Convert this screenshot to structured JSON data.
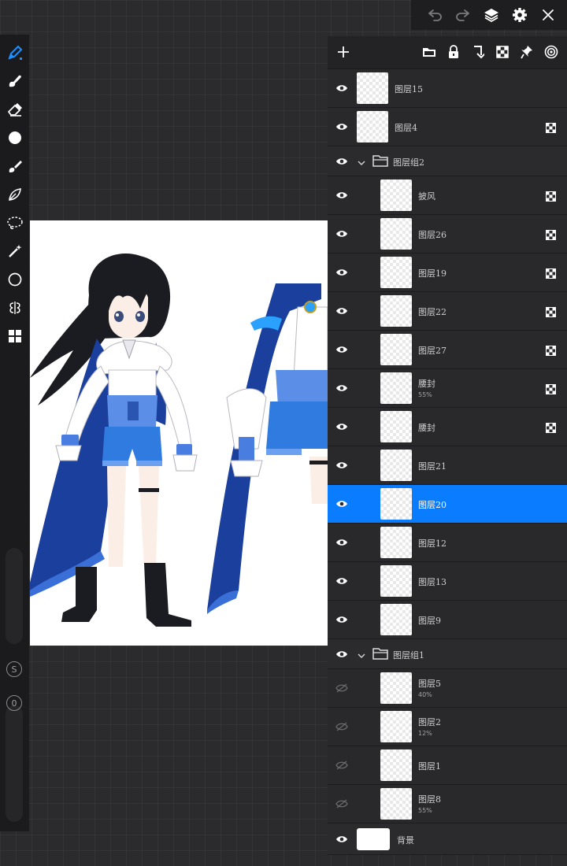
{
  "toolbar_top": {
    "icons": [
      "undo-icon",
      "redo-icon",
      "layers-icon",
      "settings-icon",
      "close-icon"
    ]
  },
  "left_tools": {
    "icons": [
      "brush-icon",
      "smudge-icon",
      "eraser-icon",
      "color-circle-icon",
      "fill-brush-icon",
      "vector-icon",
      "lasso-icon",
      "magic-wand-icon",
      "shape-circle-icon",
      "symmetry-icon",
      "grid-icon"
    ],
    "size_label": "S",
    "opacity_label": "0"
  },
  "layers_panel": {
    "add_icon": "plus-icon",
    "toolbar_icons": [
      "folder-icon",
      "lock-icon",
      "merge-down-icon",
      "checker-icon",
      "pin-icon",
      "target-icon"
    ],
    "layers": [
      {
        "kind": "layer",
        "name": "图层15",
        "opacity": "",
        "visible": true,
        "mode_icon": false,
        "indent": 0,
        "selected": false
      },
      {
        "kind": "layer",
        "name": "图层4",
        "opacity": "",
        "visible": true,
        "mode_icon": true,
        "indent": 0,
        "selected": false
      },
      {
        "kind": "group",
        "name": "图层组2",
        "visible": true
      },
      {
        "kind": "layer",
        "name": "披风",
        "opacity": "",
        "visible": true,
        "mode_icon": true,
        "indent": 1,
        "selected": false
      },
      {
        "kind": "layer",
        "name": "图层26",
        "opacity": "",
        "visible": true,
        "mode_icon": true,
        "indent": 1,
        "selected": false
      },
      {
        "kind": "layer",
        "name": "图层19",
        "opacity": "",
        "visible": true,
        "mode_icon": true,
        "indent": 1,
        "selected": false
      },
      {
        "kind": "layer",
        "name": "图层22",
        "opacity": "",
        "visible": true,
        "mode_icon": true,
        "indent": 1,
        "selected": false
      },
      {
        "kind": "layer",
        "name": "图层27",
        "opacity": "",
        "visible": true,
        "mode_icon": true,
        "indent": 1,
        "selected": false
      },
      {
        "kind": "layer",
        "name": "腰封",
        "opacity": "55%",
        "visible": true,
        "mode_icon": true,
        "indent": 1,
        "selected": false
      },
      {
        "kind": "layer",
        "name": "腰封",
        "opacity": "",
        "visible": true,
        "mode_icon": true,
        "indent": 1,
        "selected": false
      },
      {
        "kind": "layer",
        "name": "图层21",
        "opacity": "",
        "visible": true,
        "mode_icon": false,
        "indent": 1,
        "selected": false
      },
      {
        "kind": "layer",
        "name": "图层20",
        "opacity": "",
        "visible": true,
        "mode_icon": false,
        "indent": 1,
        "selected": true
      },
      {
        "kind": "layer",
        "name": "图层12",
        "opacity": "",
        "visible": true,
        "mode_icon": false,
        "indent": 1,
        "selected": false
      },
      {
        "kind": "layer",
        "name": "图层13",
        "opacity": "",
        "visible": true,
        "mode_icon": false,
        "indent": 1,
        "selected": false
      },
      {
        "kind": "layer",
        "name": "图层9",
        "opacity": "",
        "visible": true,
        "mode_icon": false,
        "indent": 1,
        "selected": false
      },
      {
        "kind": "group",
        "name": "图层组1",
        "visible": true
      },
      {
        "kind": "layer",
        "name": "图层5",
        "opacity": "40%",
        "visible": false,
        "mode_icon": false,
        "indent": 1,
        "selected": false
      },
      {
        "kind": "layer",
        "name": "图层2",
        "opacity": "12%",
        "visible": false,
        "mode_icon": false,
        "indent": 1,
        "selected": false
      },
      {
        "kind": "layer",
        "name": "图层1",
        "opacity": "",
        "visible": false,
        "mode_icon": false,
        "indent": 1,
        "selected": false
      },
      {
        "kind": "layer",
        "name": "图层8",
        "opacity": "55%",
        "visible": false,
        "mode_icon": false,
        "indent": 1,
        "selected": false
      },
      {
        "kind": "background",
        "name": "背景",
        "visible": true
      }
    ]
  },
  "colors": {
    "accent": "#0a7cff",
    "cape": "#1a3f9c",
    "shorts": "#2f7be0",
    "hair": "#1a1c22"
  }
}
